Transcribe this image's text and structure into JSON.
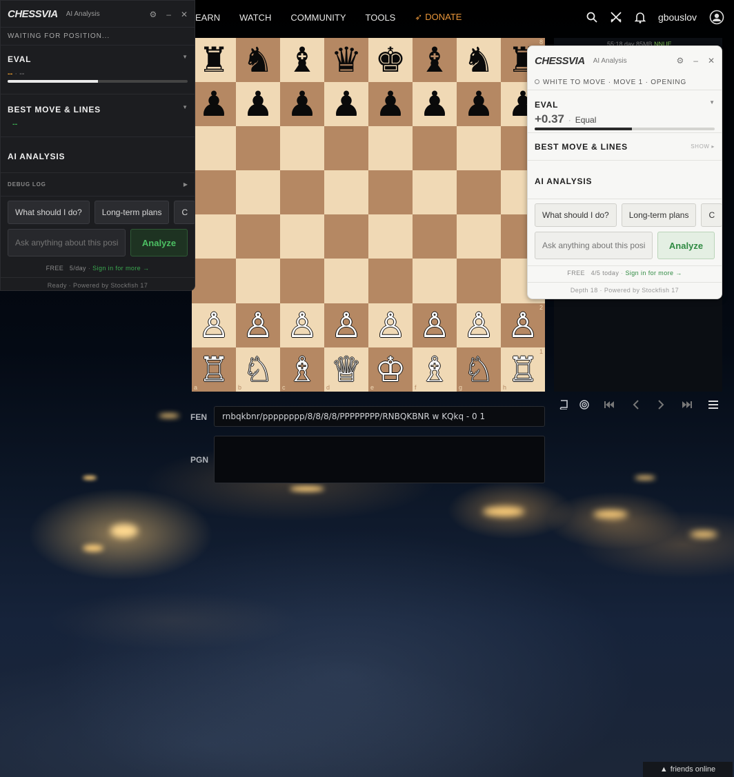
{
  "nav": {
    "items": [
      "EARN",
      "WATCH",
      "COMMUNITY",
      "TOOLS"
    ],
    "donate": "DONATE",
    "user": "gbouslov"
  },
  "board": {
    "ranks": [
      [
        "♜",
        "♞",
        "♝",
        "♛",
        "♚",
        "♝",
        "♞",
        "♜"
      ],
      [
        "♟",
        "♟",
        "♟",
        "♟",
        "♟",
        "♟",
        "♟",
        "♟"
      ],
      [
        "",
        "",
        "",
        "",
        "",
        "",
        "",
        ""
      ],
      [
        "",
        "",
        "",
        "",
        "",
        "",
        "",
        ""
      ],
      [
        "",
        "",
        "",
        "",
        "",
        "",
        "",
        ""
      ],
      [
        "",
        "",
        "",
        "",
        "",
        "",
        "",
        ""
      ],
      [
        "♙",
        "♙",
        "♙",
        "♙",
        "♙",
        "♙",
        "♙",
        "♙"
      ],
      [
        "♖",
        "♘",
        "♗",
        "♕",
        "♔",
        "♗",
        "♘",
        "♖"
      ]
    ],
    "rank_labels": [
      "8",
      "2",
      "1"
    ],
    "file_labels": [
      "a",
      "b",
      "c",
      "d",
      "e",
      "f",
      "g",
      "h"
    ]
  },
  "side": {
    "clock_text": "55:18 day 85MB",
    "status": "NNUE"
  },
  "fen": {
    "label": "FEN",
    "value": "rnbqkbnr/pppppppp/8/8/8/8/PPPPPPPP/RNBQKBNR w KQkq - 0 1"
  },
  "pgn": {
    "label": "PGN"
  },
  "dark_panel": {
    "logo": "CHESSVIA",
    "subtitle": "AI Analysis",
    "status": "WAITING FOR POSITION...",
    "eval_title": "EVAL",
    "eval_value": "--",
    "eval_sep": "·",
    "eval_desc": "--",
    "eval_bar": 0.5,
    "best_title": "BEST MOVE & LINES",
    "best_value": "--",
    "ai_title": "AI ANALYSIS",
    "debug_title": "DEBUG LOG",
    "chips": [
      "What should I do?",
      "Long-term plans",
      "C"
    ],
    "placeholder": "Ask anything about this position",
    "analyze": "Analyze",
    "free": "FREE",
    "quota": "5/day",
    "signin": "Sign in for more →",
    "ready": "Ready",
    "powered": "· Powered by Stockfish 17"
  },
  "light_panel": {
    "logo": "CHESSVIA",
    "subtitle": "AI Analysis",
    "status": "WHITE TO MOVE · MOVE 1 · OPENING",
    "eval_title": "EVAL",
    "eval_value": "+0.37",
    "eval_sep": "·",
    "eval_desc": "Equal",
    "eval_bar": 0.54,
    "best_title": "BEST MOVE & LINES",
    "best_show": "SHOW",
    "ai_title": "AI ANALYSIS",
    "chips": [
      "What should I do?",
      "Long-term plans",
      "C"
    ],
    "placeholder": "Ask anything about this position",
    "analyze": "Analyze",
    "free": "FREE",
    "quota": "4/5 today",
    "signin": "Sign in for more →",
    "depth": "Depth 18",
    "powered": "· Powered by Stockfish 17"
  },
  "friends": "friends online",
  "colors": {
    "accent_green": "#3aa84f",
    "donate": "#e8953a",
    "eval_orange": "#e89a2c",
    "light_sq": "#f0d9b5",
    "dark_sq": "#b58863"
  },
  "icons": [
    "search-icon",
    "swords-icon",
    "bell-icon",
    "user-avatar-icon",
    "gear-icon",
    "minimize-icon",
    "close-icon",
    "book-icon",
    "target-icon",
    "first-icon",
    "prev-icon",
    "next-icon",
    "last-icon",
    "menu-icon"
  ]
}
